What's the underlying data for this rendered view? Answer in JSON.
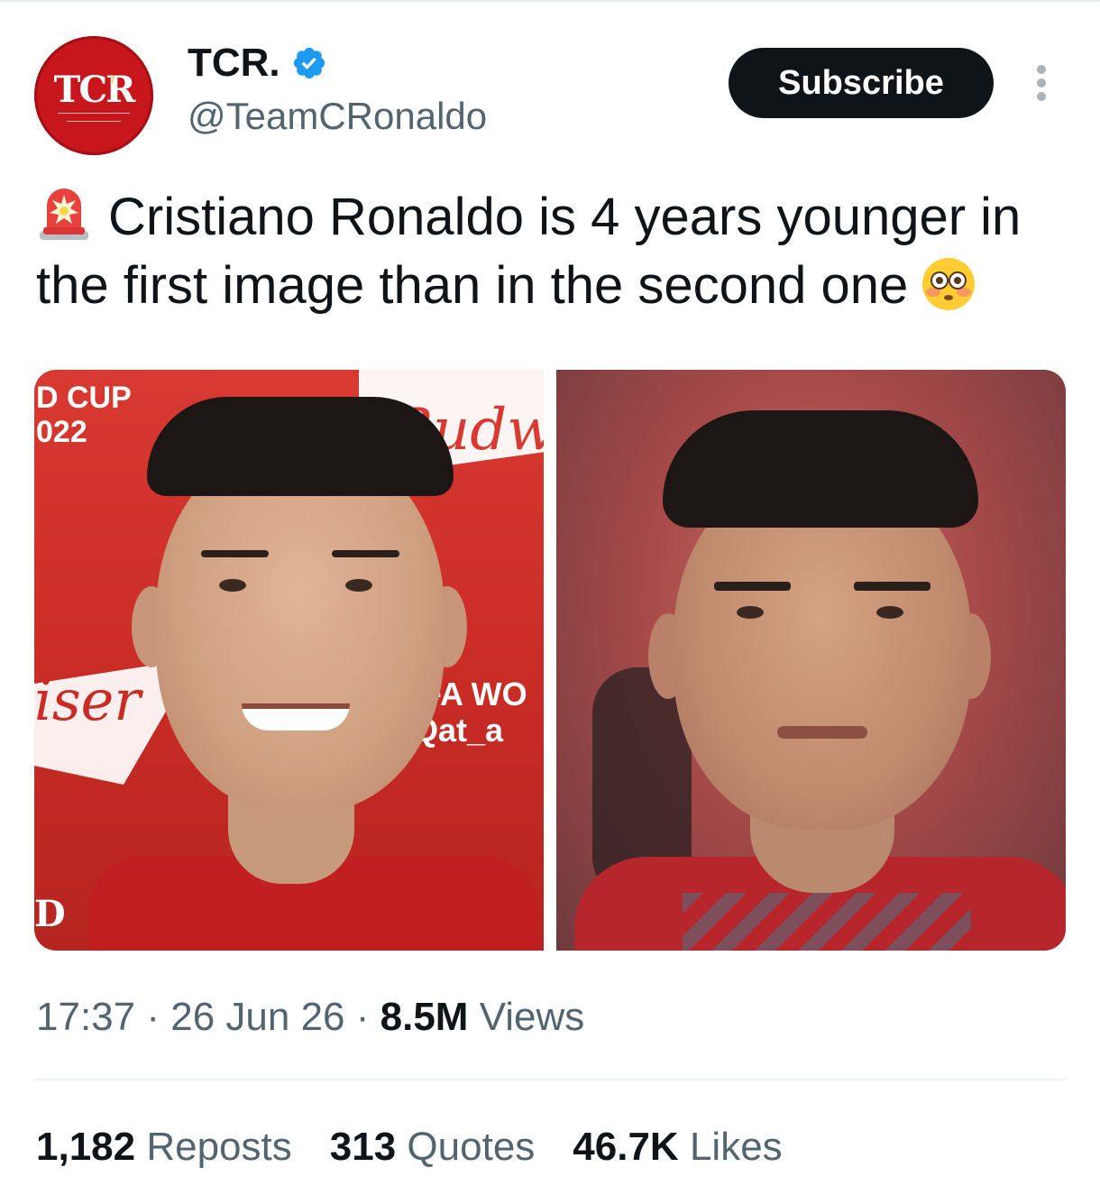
{
  "author": {
    "display_name": "TCR.",
    "handle": "@TeamCRonaldo",
    "avatar_text": "TCR",
    "verified_icon": "verified-badge-icon",
    "verified_color": "#1d9bf0"
  },
  "actions": {
    "subscribe_label": "Subscribe",
    "more_icon": "more-vertical-icon"
  },
  "tweet": {
    "leading_emoji": "police-siren-emoji",
    "text": "Cristiano Ronaldo is 4 years younger in the first image than in the second one",
    "trailing_emoji": "flushed-face-emoji"
  },
  "media": {
    "photo1": {
      "cup_line1": "D CUP",
      "cup_line2": "022",
      "banner_text": "Budw",
      "side_text": "iser",
      "wc_line1": "IFA WO",
      "wc_line2": "Qat_a",
      "corner_text": "D"
    }
  },
  "meta": {
    "time": "17:37",
    "separator1": "·",
    "date": "26 Jun 26",
    "separator2": "·",
    "views_count": "8.5M",
    "views_label": "Views"
  },
  "stats": {
    "reposts_count": "1,182",
    "reposts_label": "Reposts",
    "quotes_count": "313",
    "quotes_label": "Quotes",
    "likes_count": "46.7K",
    "likes_label": "Likes"
  },
  "colors": {
    "text_primary": "#0f1419",
    "text_secondary": "#536471",
    "button_bg": "#0f1419"
  }
}
